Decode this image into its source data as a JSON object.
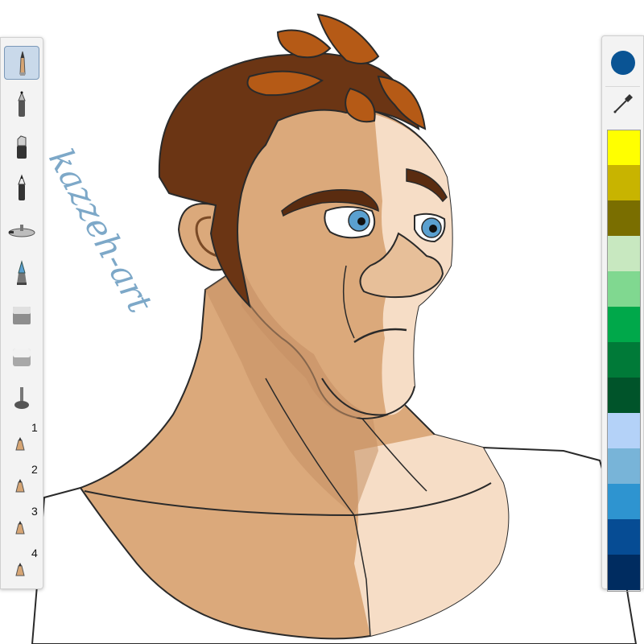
{
  "artwork": {
    "signature_text": "kazzeh-art"
  },
  "left_toolbar": {
    "tools": [
      {
        "name": "pencil",
        "icon": "pencil-icon",
        "active": true
      },
      {
        "name": "ballpoint-pen",
        "icon": "ballpoint-pen-icon",
        "active": false
      },
      {
        "name": "marker",
        "icon": "marker-icon",
        "active": false
      },
      {
        "name": "felt-pen",
        "icon": "felt-pen-icon",
        "active": false
      },
      {
        "name": "airbrush",
        "icon": "airbrush-icon",
        "active": false
      },
      {
        "name": "paintbrush",
        "icon": "paintbrush-icon",
        "active": false
      },
      {
        "name": "hard-eraser",
        "icon": "hard-eraser-icon",
        "active": false
      },
      {
        "name": "soft-eraser",
        "icon": "soft-eraser-icon",
        "active": false
      },
      {
        "name": "smudge",
        "icon": "smudge-icon",
        "active": false
      }
    ],
    "custom_slots": [
      {
        "number": "1",
        "icon": "custom-brush-icon"
      },
      {
        "number": "2",
        "icon": "custom-brush-icon"
      },
      {
        "number": "3",
        "icon": "custom-brush-icon"
      },
      {
        "number": "4",
        "icon": "custom-brush-icon"
      }
    ]
  },
  "right_panel": {
    "current_color": "#0a5494",
    "eyedropper_icon": "eyedropper-icon",
    "swatches": [
      "#ffff00",
      "#c8b400",
      "#7a6e00",
      "#c8e8c0",
      "#80d890",
      "#00a84a",
      "#007a38",
      "#00542a",
      "#b4d2f8",
      "#78b4d8",
      "#2e94d0",
      "#064c94",
      "#002c60"
    ]
  }
}
